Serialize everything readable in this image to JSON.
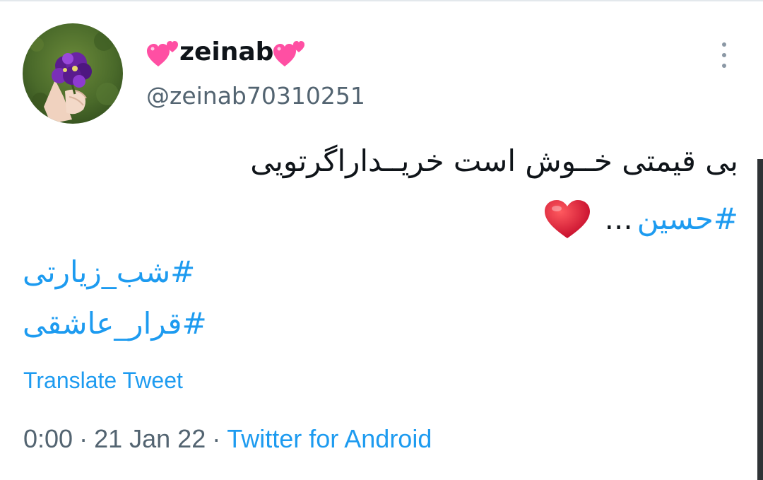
{
  "user": {
    "display_name": "zeinab",
    "handle": "@zeinab70310251",
    "avatar_icon": "flower-bouquet-avatar"
  },
  "tweet": {
    "line1": "بی قیمتی خــوش است خریــداراگرتویی",
    "hashtag_main": "#حسین",
    "ellipsis": "...",
    "heart_emoji": "red-heart-emoji",
    "tag2": "#شب_زیارتی",
    "tag3": "#قرار_عاشقی"
  },
  "translate_label": "Translate Tweet",
  "meta": {
    "time": "0:00",
    "date": "21 Jan 22",
    "separator": "·",
    "source": "Twitter for Android"
  },
  "colors": {
    "accent": "#1d9bf0",
    "secondary_text": "#536471",
    "heart_pink": "#ff4fa3",
    "heart_red": "#e0142b"
  }
}
